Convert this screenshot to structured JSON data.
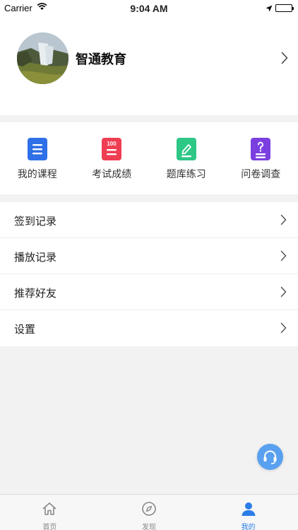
{
  "status_bar": {
    "carrier": "Carrier",
    "time": "9:04 AM"
  },
  "profile": {
    "name": "智通教育"
  },
  "quick_actions": [
    {
      "label": "我的课程",
      "icon": "course-icon",
      "color": "#2f6fe8"
    },
    {
      "label": "考试成绩",
      "icon": "score-100-icon",
      "color": "#ef3d52",
      "badge": "100"
    },
    {
      "label": "题库练习",
      "icon": "practice-icon",
      "color": "#2dc786"
    },
    {
      "label": "问卷调查",
      "icon": "survey-icon",
      "color": "#7b3fe0"
    }
  ],
  "menu": [
    {
      "label": "签到记录"
    },
    {
      "label": "播放记录"
    },
    {
      "label": "推荐好友"
    },
    {
      "label": "设置"
    }
  ],
  "tabbar": [
    {
      "label": "首页",
      "icon": "home-icon",
      "active": false
    },
    {
      "label": "发现",
      "icon": "compass-icon",
      "active": false
    },
    {
      "label": "我的",
      "icon": "user-icon",
      "active": true
    }
  ],
  "colors": {
    "accent": "#2b7de9",
    "support": "#5aa0f0"
  }
}
